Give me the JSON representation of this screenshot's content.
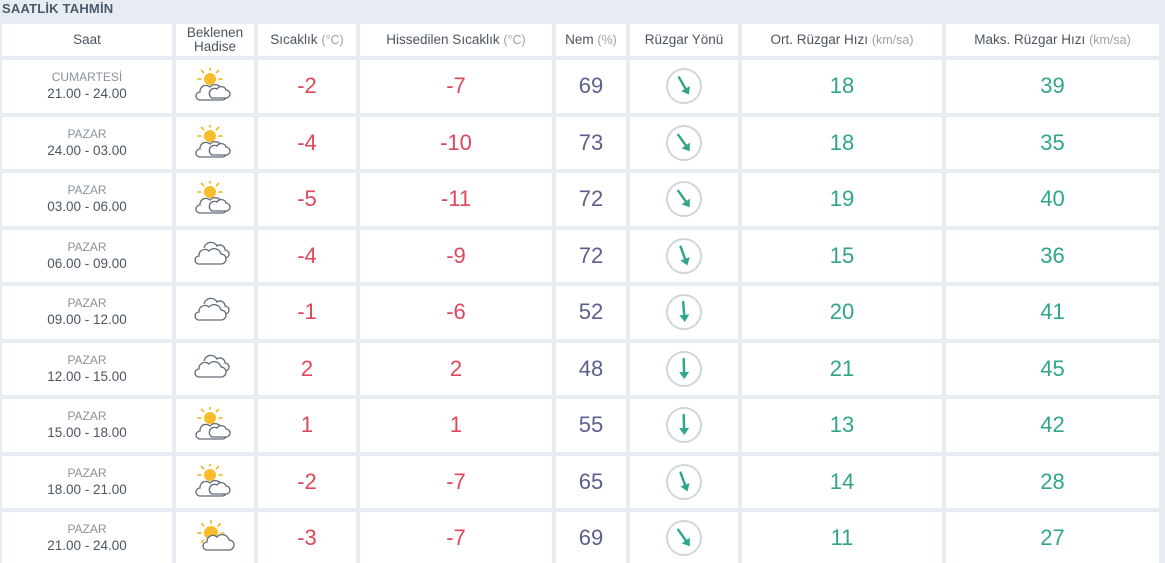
{
  "title": "SAATLİK TAHMİN",
  "headers": {
    "saat": "Saat",
    "hadise_line1": "Beklenen",
    "hadise_line2": "Hadise",
    "sicaklik": "Sıcaklık",
    "sicaklik_unit": "(°C)",
    "hissedilen": "Hissedilen Sıcaklık",
    "hissedilen_unit": "(°C)",
    "nem": "Nem",
    "nem_unit": "(%)",
    "ruzgar_yonu": "Rüzgar Yönü",
    "ort_ruzgar": "Ort. Rüzgar Hızı",
    "ort_ruzgar_unit": "(km/sa)",
    "maks_ruzgar": "Maks. Rüzgar Hızı",
    "maks_ruzgar_unit": "(km/sa)"
  },
  "colors": {
    "temperature": "#e0465a",
    "humidity": "#5c5f8e",
    "wind": "#2fa689"
  },
  "rows": [
    {
      "day": "CUMARTESİ",
      "range": "21.00 - 24.00",
      "icon": "partly-cloudy-icon",
      "temp": "-2",
      "feels": "-7",
      "humidity": "69",
      "wind_dir_deg": 150,
      "wind_avg": "18",
      "wind_max": "39"
    },
    {
      "day": "PAZAR",
      "range": "24.00 - 03.00",
      "icon": "partly-cloudy-icon",
      "temp": "-4",
      "feels": "-10",
      "humidity": "73",
      "wind_dir_deg": 145,
      "wind_avg": "18",
      "wind_max": "35"
    },
    {
      "day": "PAZAR",
      "range": "03.00 - 06.00",
      "icon": "partly-cloudy-icon",
      "temp": "-5",
      "feels": "-11",
      "humidity": "72",
      "wind_dir_deg": 145,
      "wind_avg": "19",
      "wind_max": "40"
    },
    {
      "day": "PAZAR",
      "range": "06.00 - 09.00",
      "icon": "cloudy-icon",
      "temp": "-4",
      "feels": "-9",
      "humidity": "72",
      "wind_dir_deg": 160,
      "wind_avg": "15",
      "wind_max": "36"
    },
    {
      "day": "PAZAR",
      "range": "09.00 - 12.00",
      "icon": "cloudy-icon",
      "temp": "-1",
      "feels": "-6",
      "humidity": "52",
      "wind_dir_deg": 175,
      "wind_avg": "20",
      "wind_max": "41"
    },
    {
      "day": "PAZAR",
      "range": "12.00 - 15.00",
      "icon": "cloudy-icon",
      "temp": "2",
      "feels": "2",
      "humidity": "48",
      "wind_dir_deg": 178,
      "wind_avg": "21",
      "wind_max": "45"
    },
    {
      "day": "PAZAR",
      "range": "15.00 - 18.00",
      "icon": "partly-cloudy-icon",
      "temp": "1",
      "feels": "1",
      "humidity": "55",
      "wind_dir_deg": 178,
      "wind_avg": "13",
      "wind_max": "42"
    },
    {
      "day": "PAZAR",
      "range": "18.00 - 21.00",
      "icon": "partly-cloudy-icon",
      "temp": "-2",
      "feels": "-7",
      "humidity": "65",
      "wind_dir_deg": 160,
      "wind_avg": "14",
      "wind_max": "28"
    },
    {
      "day": "PAZAR",
      "range": "21.00 - 24.00",
      "icon": "sun-cloud-icon",
      "temp": "-3",
      "feels": "-7",
      "humidity": "69",
      "wind_dir_deg": 145,
      "wind_avg": "11",
      "wind_max": "27"
    }
  ]
}
